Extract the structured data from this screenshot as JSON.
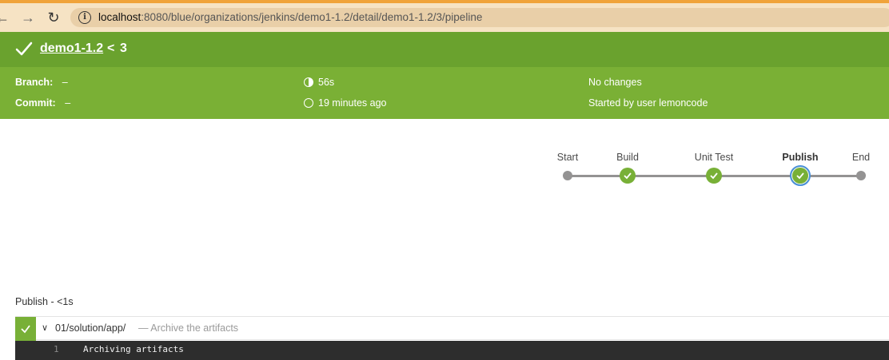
{
  "browser": {
    "back_icon": "arrow-left-icon",
    "forward_icon": "arrow-right-icon",
    "reload_icon": "reload-icon",
    "url_host": "localhost",
    "url_rest": ":8080/blue/organizations/jenkins/demo1-1.2/detail/demo1-1.2/3/pipeline"
  },
  "header": {
    "pipeline_name": "demo1-1.2",
    "separator": "<",
    "run_number": "3"
  },
  "summary": {
    "branch_label": "Branch:",
    "branch_value": "–",
    "commit_label": "Commit:",
    "commit_value": "–",
    "duration": "56s",
    "time_ago": "19 minutes ago",
    "changes": "No changes",
    "started_by": "Started by user lemoncode"
  },
  "pipeline": {
    "stages": [
      {
        "label": "Start",
        "state": "start"
      },
      {
        "label": "Build",
        "state": "success"
      },
      {
        "label": "Unit Test",
        "state": "success"
      },
      {
        "label": "Publish",
        "state": "success-selected"
      },
      {
        "label": "End",
        "state": "end"
      }
    ]
  },
  "step": {
    "title": "Publish - <1s",
    "directory": "01/solution/app/",
    "description": "— Archive the artifacts",
    "log_line_number": "1",
    "log_line_text": "Archiving artifacts"
  },
  "colors": {
    "header_green": "#6aa22e",
    "panel_green": "#7ab035",
    "success_green": "#78b037",
    "selected_ring": "#4a90d9"
  }
}
